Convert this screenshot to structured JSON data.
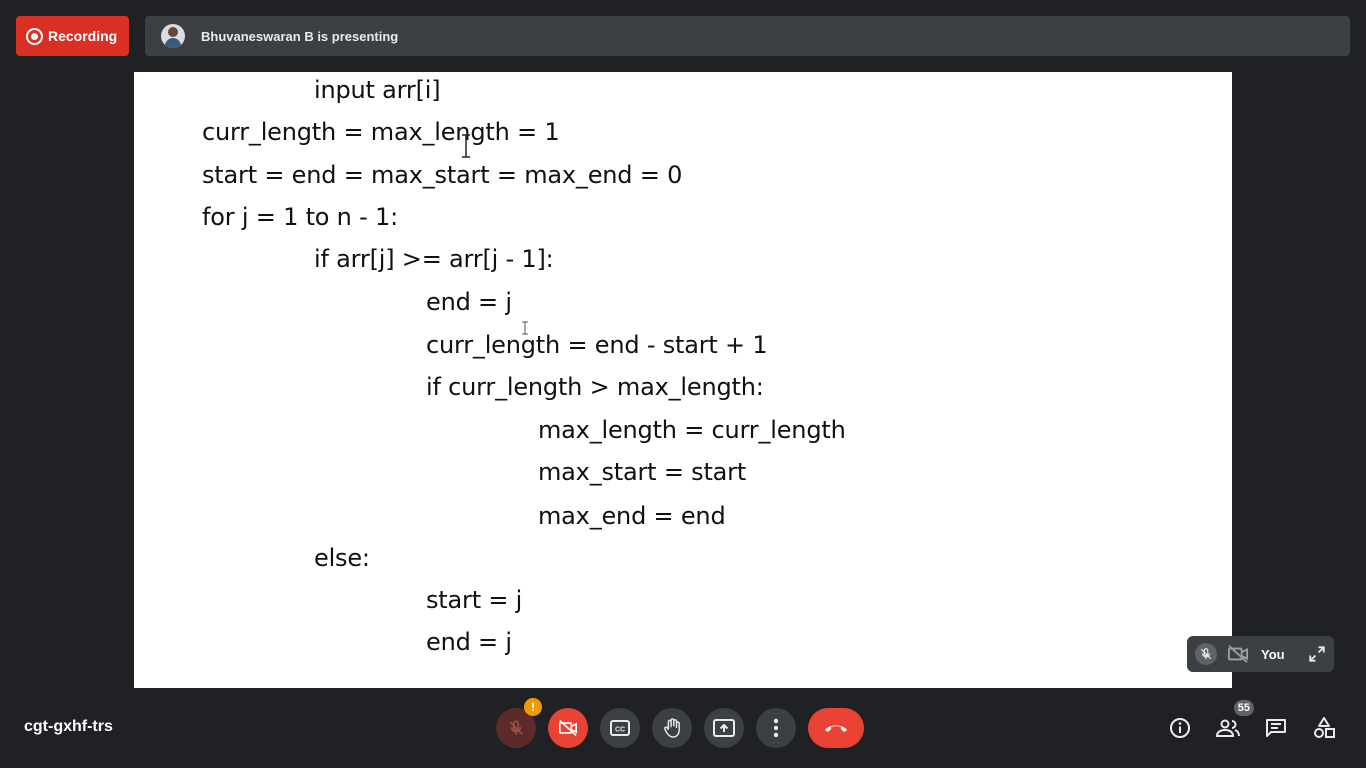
{
  "top_bar": {
    "recording_label": "Recording",
    "presenter_text": "Bhuvaneswaran B is presenting"
  },
  "slide": {
    "lines": [
      "input arr[i]",
      "curr_length = max_length = 1",
      "start = end = max_start = max_end = 0",
      "for j = 1 to n - 1:",
      "if arr[j] >= arr[j - 1]:",
      "end = j",
      "curr_length = end - start + 1",
      "if curr_length > max_length:",
      "max_length = curr_length",
      "max_start = start",
      "max_end = end",
      "else:",
      "start = j",
      "end = j"
    ]
  },
  "self_view": {
    "label": "You"
  },
  "bottom_bar": {
    "meeting_code": "cgt-gxhf-trs",
    "mic_warning": "!",
    "participant_count": "55"
  },
  "colors": {
    "background": "#202124",
    "recording_red": "#d93025",
    "end_call_red": "#ea4335",
    "control_grey": "#3c4043",
    "warning_orange": "#f29900"
  },
  "icons": [
    "record-icon",
    "avatar",
    "mic-off-icon",
    "camera-off-icon",
    "captions-icon",
    "raise-hand-icon",
    "present-icon",
    "more-vert-icon",
    "end-call-icon",
    "info-icon",
    "people-icon",
    "chat-icon",
    "activities-icon",
    "expand-icon"
  ]
}
